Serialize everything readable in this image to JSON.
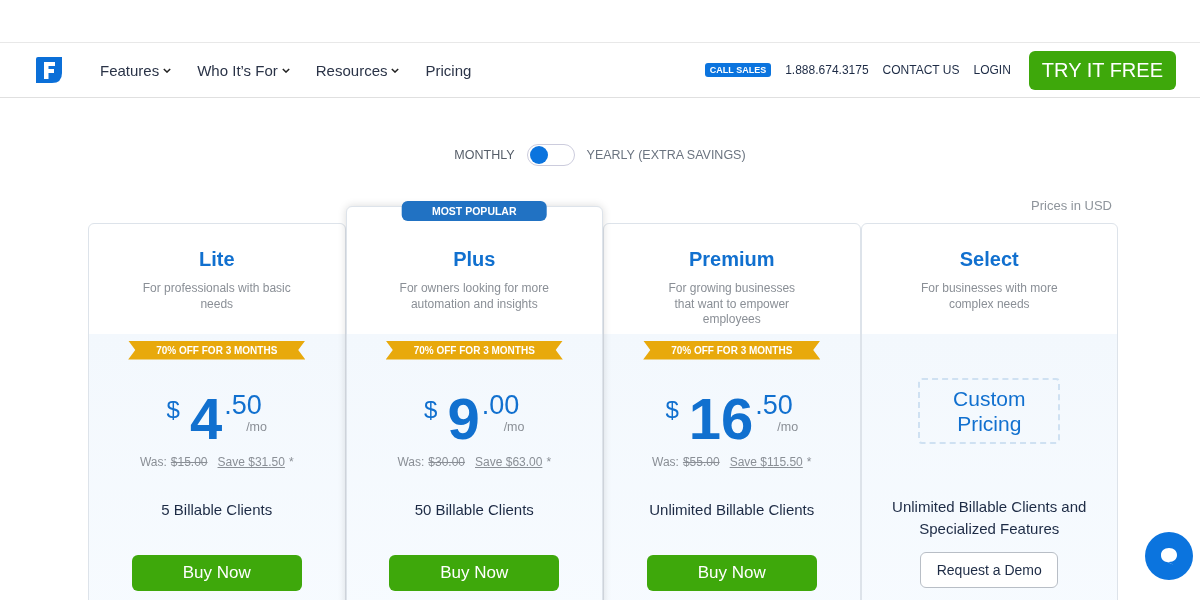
{
  "header": {
    "nav": [
      {
        "label": "Features",
        "dropdown": true
      },
      {
        "label": "Who It’s For",
        "dropdown": true
      },
      {
        "label": "Resources",
        "dropdown": true
      },
      {
        "label": "Pricing",
        "dropdown": false
      }
    ],
    "call_badge": "CALL SALES",
    "phone": "1.888.674.3175",
    "contact": "CONTACT US",
    "login": "LOGIN",
    "cta": "TRY IT FREE"
  },
  "billing": {
    "monthly_label": "MONTHLY",
    "yearly_label": "YEARLY (EXTRA SAVINGS)",
    "yearly": false
  },
  "currency_note": "Prices in USD",
  "plans": [
    {
      "name": "Lite",
      "description": "For professionals with basic needs",
      "featured": false,
      "ribbon": "70% OFF FOR 3 MONTHS",
      "kind": "price",
      "currency": "$",
      "whole": "4",
      "cents": ".50",
      "period": "/mo",
      "was_label": "Was:",
      "was": "$15.00",
      "save": "Save $31.50",
      "save_mark": "*",
      "clients": "5 Billable Clients",
      "button": {
        "label": "Buy Now",
        "kind": "primary"
      }
    },
    {
      "name": "Plus",
      "badge": "MOST POPULAR",
      "description": "For owners looking for more automation and insights",
      "featured": true,
      "ribbon": "70% OFF FOR 3 MONTHS",
      "kind": "price",
      "currency": "$",
      "whole": "9",
      "cents": ".00",
      "period": "/mo",
      "was_label": "Was:",
      "was": "$30.00",
      "save": "Save $63.00",
      "save_mark": "*",
      "clients": "50 Billable Clients",
      "button": {
        "label": "Buy Now",
        "kind": "primary"
      }
    },
    {
      "name": "Premium",
      "description": "For growing businesses that want to empower employees",
      "featured": false,
      "ribbon": "70% OFF FOR 3 MONTHS",
      "kind": "price",
      "currency": "$",
      "whole": "16",
      "cents": ".50",
      "period": "/mo",
      "was_label": "Was:",
      "was": "$55.00",
      "save": "Save $115.50",
      "save_mark": "*",
      "clients": "Unlimited Billable Clients",
      "button": {
        "label": "Buy Now",
        "kind": "primary"
      }
    },
    {
      "name": "Select",
      "description": "For businesses with more complex needs",
      "featured": false,
      "kind": "custom",
      "custom_price": "Custom Pricing",
      "clients": "Unlimited Billable Clients and Specialized Features",
      "button": {
        "label": "Request a Demo",
        "kind": "outline"
      }
    }
  ]
}
